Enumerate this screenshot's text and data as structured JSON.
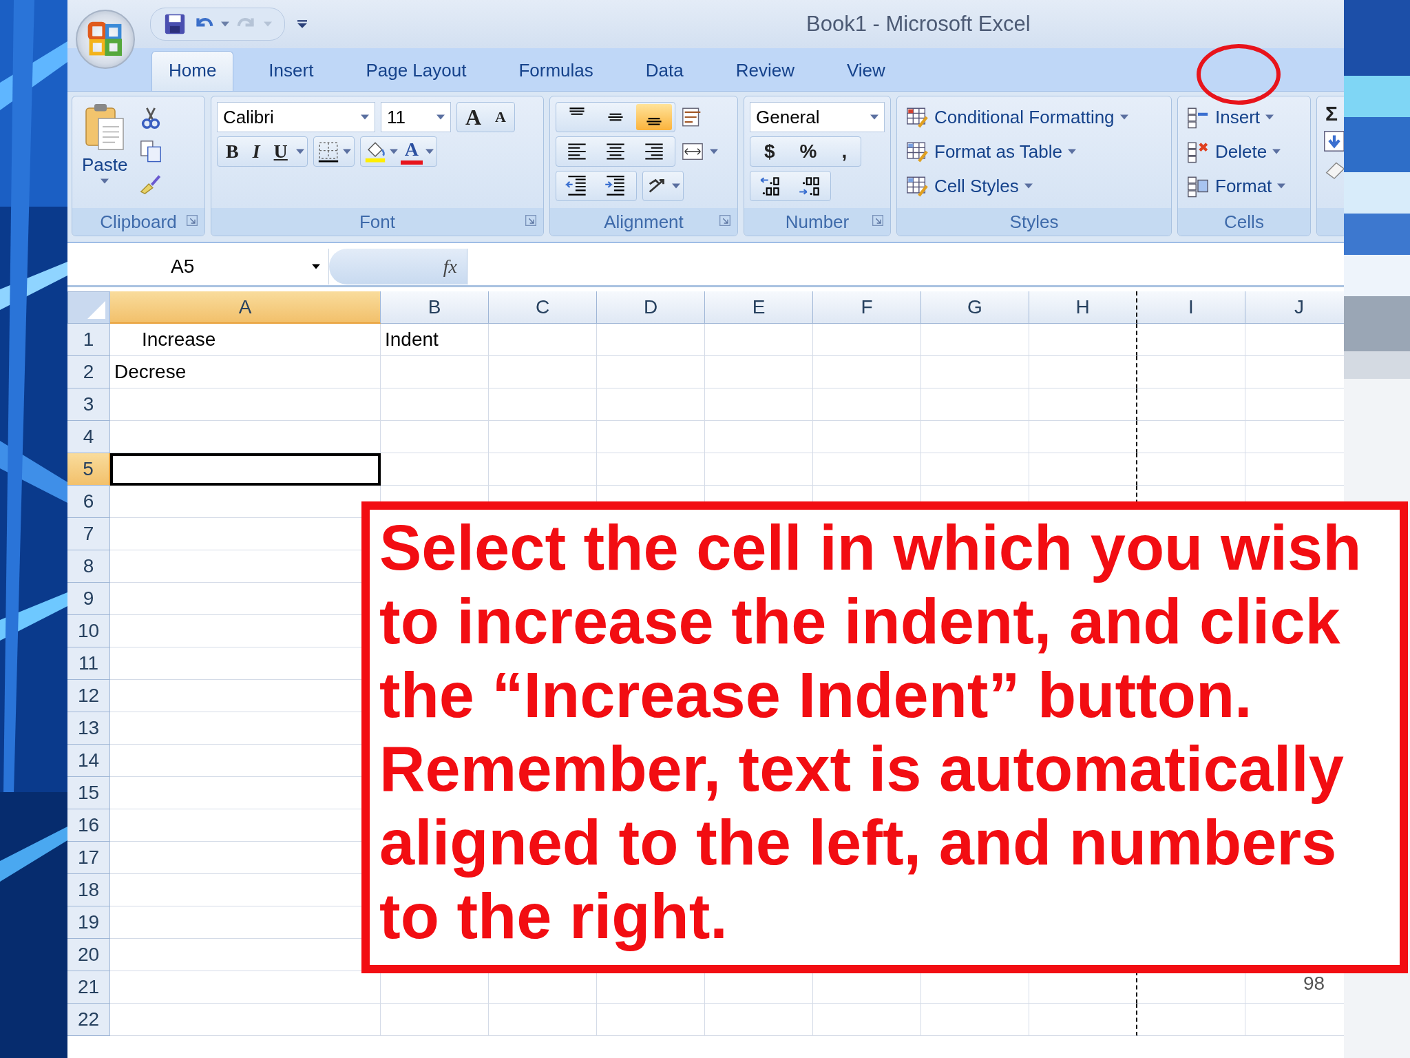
{
  "window": {
    "title": "Book1  -  Microsoft Excel"
  },
  "tabs": [
    {
      "label": "Home",
      "selected": true
    },
    {
      "label": "Insert",
      "selected": false
    },
    {
      "label": "Page Layout",
      "selected": false
    },
    {
      "label": "Formulas",
      "selected": false
    },
    {
      "label": "Data",
      "selected": false
    },
    {
      "label": "Review",
      "selected": false
    },
    {
      "label": "View",
      "selected": false
    }
  ],
  "ribbon": {
    "clipboard": {
      "label": "Clipboard",
      "paste": "Paste"
    },
    "font": {
      "label": "Font",
      "name": "Calibri",
      "size": "11",
      "size_buttons": [
        "A",
        "A"
      ],
      "style_buttons": [
        "B",
        "I",
        "U"
      ],
      "color_button": "A"
    },
    "alignment": {
      "label": "Alignment",
      "vertical": [
        {
          "selected": false
        },
        {
          "selected": false
        },
        {
          "selected": true
        }
      ]
    },
    "number": {
      "label": "Number",
      "format": "General",
      "symbols": [
        "$",
        "%",
        ","
      ]
    },
    "styles": {
      "label": "Styles",
      "items": [
        "Conditional Formatting",
        "Format as Table",
        "Cell Styles"
      ]
    },
    "cells": {
      "label": "Cells",
      "items": [
        "Insert",
        "Delete",
        "Format"
      ]
    },
    "editing": {
      "symbol": "Σ"
    }
  },
  "formula_bar": {
    "name_box": "A5",
    "function_label": "fx"
  },
  "sheet": {
    "columns": [
      {
        "label": "A",
        "selected": true,
        "page_break": false
      },
      {
        "label": "B",
        "selected": false,
        "page_break": false
      },
      {
        "label": "C",
        "selected": false,
        "page_break": false
      },
      {
        "label": "D",
        "selected": false,
        "page_break": false
      },
      {
        "label": "E",
        "selected": false,
        "page_break": false
      },
      {
        "label": "F",
        "selected": false,
        "page_break": false
      },
      {
        "label": "G",
        "selected": false,
        "page_break": false
      },
      {
        "label": "H",
        "selected": false,
        "page_break": true
      },
      {
        "label": "I",
        "selected": false,
        "page_break": false
      },
      {
        "label": "J",
        "selected": false,
        "page_break": false
      }
    ],
    "rows": [
      {
        "label": "1",
        "selected": false,
        "cells": [
          {
            "text": "Increase",
            "indented": true,
            "active": false
          },
          {
            "text": "Indent",
            "indented": false,
            "active": false
          }
        ]
      },
      {
        "label": "2",
        "selected": false,
        "cells": [
          {
            "text": "Decrese",
            "indented": false,
            "active": false
          }
        ]
      },
      {
        "label": "3",
        "selected": false
      },
      {
        "label": "4",
        "selected": false
      },
      {
        "label": "5",
        "selected": true,
        "cells": [
          {
            "active": true
          }
        ]
      },
      {
        "label": "6",
        "selected": false
      },
      {
        "label": "7",
        "selected": false
      },
      {
        "label": "8",
        "selected": false
      },
      {
        "label": "9",
        "selected": false
      },
      {
        "label": "10",
        "selected": false
      },
      {
        "label": "11",
        "selected": false
      },
      {
        "label": "12",
        "selected": false
      },
      {
        "label": "13",
        "selected": false
      },
      {
        "label": "14",
        "selected": false
      },
      {
        "label": "15",
        "selected": false
      },
      {
        "label": "16",
        "selected": false
      },
      {
        "label": "17",
        "selected": false
      },
      {
        "label": "18",
        "selected": false
      },
      {
        "label": "19",
        "selected": false
      },
      {
        "label": "20",
        "selected": false
      },
      {
        "label": "21",
        "selected": false
      },
      {
        "label": "22",
        "selected": false
      }
    ]
  },
  "callout": {
    "text": "Select the cell in which you wish to increase the indent, and click the “Increase Indent” button. Remember, text is automatically aligned to the left, and numbers to the right."
  },
  "slide_number": "98"
}
